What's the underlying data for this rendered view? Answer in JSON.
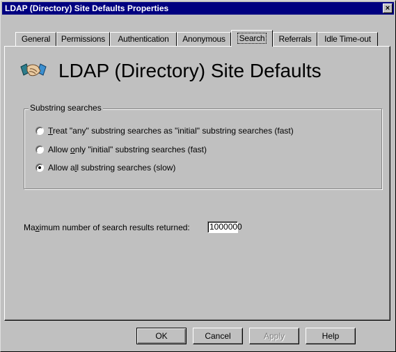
{
  "window": {
    "title": "LDAP (Directory) Site Defaults Properties",
    "close_label": "×"
  },
  "tabs": [
    {
      "label": "General"
    },
    {
      "label": "Permissions"
    },
    {
      "label": "Authentication"
    },
    {
      "label": "Anonymous"
    },
    {
      "label": "Search",
      "selected": true
    },
    {
      "label": "Referrals"
    },
    {
      "label": "Idle Time-out"
    }
  ],
  "heading": {
    "icon": "handshake-icon",
    "text": "LDAP (Directory) Site Defaults"
  },
  "substring_group": {
    "legend": "Substring searches",
    "options": [
      {
        "mnemonic": "T",
        "rest": "reat \"any\" substring searches as \"initial\" substring searches (fast)",
        "selected": false
      },
      {
        "pre": "Allow ",
        "mnemonic": "o",
        "rest": "nly \"initial\" substring searches (fast)",
        "selected": false
      },
      {
        "pre": "Allow a",
        "mnemonic": "l",
        "rest": "l substring searches (slow)",
        "selected": true
      }
    ]
  },
  "max_results": {
    "label_pre": "Ma",
    "label_mnemonic": "x",
    "label_rest": "imum number of search results returned:",
    "value": "1000000"
  },
  "buttons": {
    "ok": "OK",
    "cancel": "Cancel",
    "apply": "Apply",
    "help": "Help"
  }
}
